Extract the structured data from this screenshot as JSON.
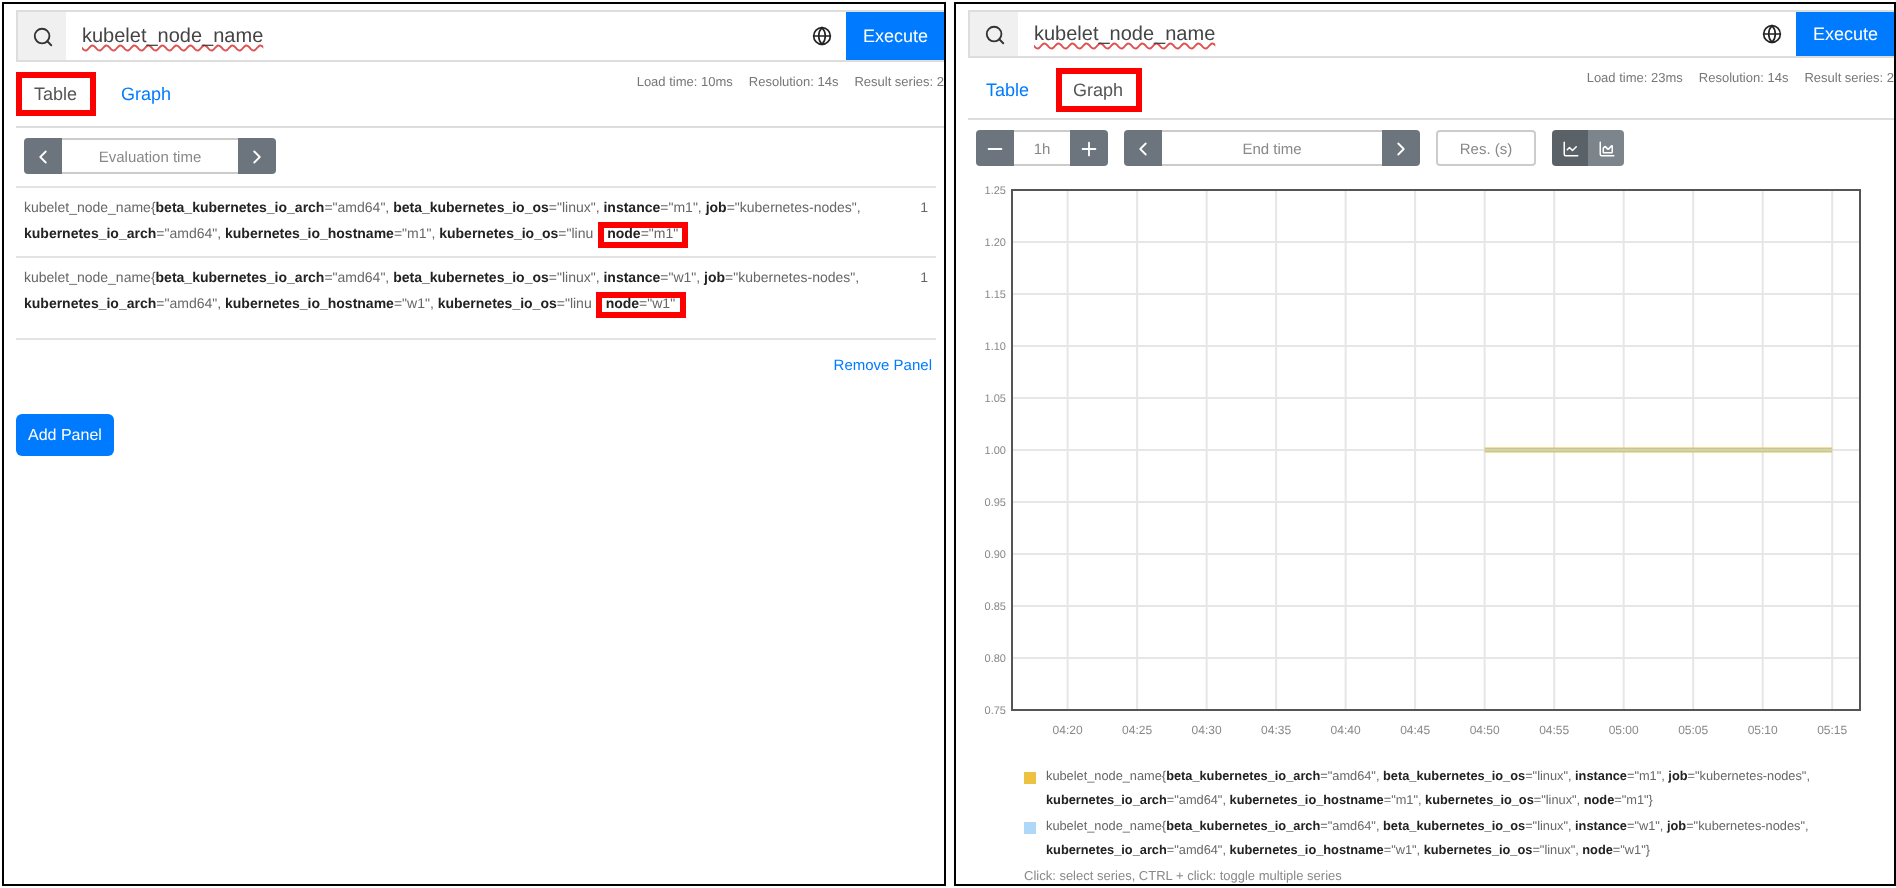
{
  "panels": [
    {
      "kind": "table",
      "query": "kubelet_node_name",
      "execute": "Execute",
      "tabs": [
        {
          "label": "Table",
          "selected": true,
          "highlighted": true
        },
        {
          "label": "Graph",
          "selected": false,
          "highlighted": false
        }
      ],
      "stats": [
        "Load time: 10ms",
        "Resolution: 14s",
        "Result series: 2"
      ],
      "eval_time": {
        "placeholder": "Evaluation time"
      },
      "rows": [
        {
          "metric": "kubelet_node_name{**beta_kubernetes_io_arch**=\"amd64\", **beta_kubernetes_io_os**=\"linux\", **instance**=\"m1\", **job**=\"kubernetes-nodes\", **kubernetes_io_arch**=\"amd64\", **kubernetes_io_hostname**=\"m1\", **kubernetes_io_os**=\"linu",
          "highlight": "**node**=\"m1\"",
          "value": "1"
        },
        {
          "metric": "kubelet_node_name{**beta_kubernetes_io_arch**=\"amd64\", **beta_kubernetes_io_os**=\"linux\", **instance**=\"w1\", **job**=\"kubernetes-nodes\", **kubernetes_io_arch**=\"amd64\", **kubernetes_io_hostname**=\"w1\", **kubernetes_io_os**=\"linu",
          "highlight": "**node**=\"w1\"",
          "value": "1"
        }
      ],
      "remove": "Remove Panel",
      "add_panel": "Add Panel"
    },
    {
      "kind": "graph",
      "query": "kubelet_node_name",
      "execute": "Execute",
      "tabs": [
        {
          "label": "Table",
          "selected": false,
          "highlighted": false
        },
        {
          "label": "Graph",
          "selected": true,
          "highlighted": true
        }
      ],
      "stats": [
        "Load time: 23ms",
        "Resolution: 14s",
        "Result series: 2"
      ],
      "range": "1h",
      "end_time": {
        "placeholder": "End time"
      },
      "resolution": {
        "placeholder": "Res. (s)"
      },
      "modes": [
        {
          "kind": "line",
          "selected": true
        },
        {
          "kind": "stacked",
          "selected": false
        }
      ],
      "chart_data": {
        "type": "line",
        "grid": true,
        "ylim": [
          0.75,
          1.25
        ],
        "categories": [
          "04:20",
          "04:25",
          "04:30",
          "04:35",
          "04:40",
          "04:45",
          "04:50",
          "04:55",
          "05:00",
          "05:05",
          "05:10",
          "05:15"
        ],
        "series": [
          {
            "color": "#edc240",
            "values": [
              null,
              null,
              null,
              null,
              null,
              null,
              1,
              1,
              1,
              1,
              1,
              1
            ]
          },
          {
            "color": "#afd8f8",
            "values": [
              null,
              null,
              null,
              null,
              null,
              null,
              1,
              1,
              1,
              1,
              1,
              1
            ]
          }
        ],
        "yticks": [
          {
            "value": 0.75,
            "label": "0.75"
          },
          {
            "value": 0.8,
            "label": "0.80"
          },
          {
            "value": 0.85,
            "label": "0.85"
          },
          {
            "value": 0.9,
            "label": "0.90"
          },
          {
            "value": 0.95,
            "label": "0.95"
          },
          {
            "value": 1.0,
            "label": "1.00"
          },
          {
            "value": 1.05,
            "label": "1.05"
          },
          {
            "value": 1.1,
            "label": "1.10"
          },
          {
            "value": 1.15,
            "label": "1.15"
          },
          {
            "value": 1.2,
            "label": "1.20"
          },
          {
            "value": 1.25,
            "label": "1.25"
          }
        ]
      },
      "legend": [
        {
          "color": "#edc240",
          "text": "kubelet_node_name{**beta_kubernetes_io_arch**=\"amd64\", **beta_kubernetes_io_os**=\"linux\", **instance**=\"m1\", **job**=\"kubernetes-nodes\", **kubernetes_io_arch**=\"amd64\", **kubernetes_io_hostname**=\"m1\", **kubernetes_io_os**=\"linux\", **node**=\"m1\"}"
        },
        {
          "color": "#afd8f8",
          "text": "kubelet_node_name{**beta_kubernetes_io_arch**=\"amd64\", **beta_kubernetes_io_os**=\"linux\", **instance**=\"w1\", **job**=\"kubernetes-nodes\", **kubernetes_io_arch**=\"amd64\", **kubernetes_io_hostname**=\"w1\", **kubernetes_io_os**=\"linux\", **node**=\"w1\"}"
        }
      ],
      "hint": "Click: select series, CTRL + click: toggle multiple series"
    }
  ]
}
